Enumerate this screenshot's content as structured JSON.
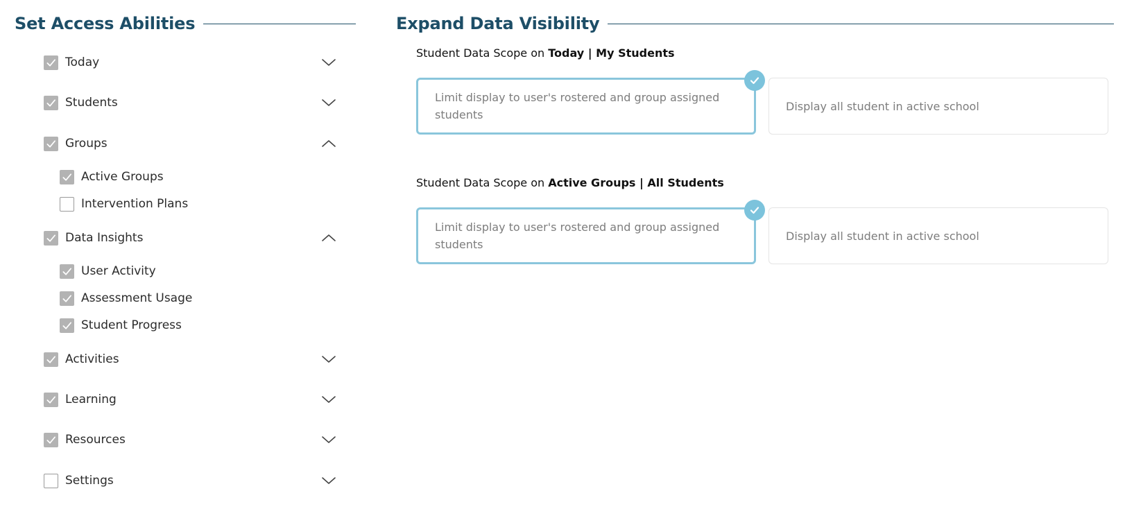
{
  "access": {
    "title": "Set Access Abilities",
    "items": [
      {
        "label": "Today",
        "checked": true,
        "chevron": "chevron-down-icon"
      },
      {
        "label": "Students",
        "checked": true,
        "chevron": "chevron-down-icon"
      },
      {
        "label": "Groups",
        "checked": true,
        "chevron": "chevron-up-icon",
        "children": [
          {
            "label": "Active Groups",
            "checked": true
          },
          {
            "label": "Intervention Plans",
            "checked": false
          }
        ]
      },
      {
        "label": "Data Insights",
        "checked": true,
        "chevron": "chevron-up-icon",
        "children": [
          {
            "label": "User Activity",
            "checked": true
          },
          {
            "label": "Assessment Usage",
            "checked": true
          },
          {
            "label": "Student Progress",
            "checked": true
          }
        ]
      },
      {
        "label": "Activities",
        "checked": true,
        "chevron": "chevron-down-icon"
      },
      {
        "label": "Learning",
        "checked": true,
        "chevron": "chevron-down-icon"
      },
      {
        "label": "Resources",
        "checked": true,
        "chevron": "chevron-down-icon"
      },
      {
        "label": "Settings",
        "checked": false,
        "chevron": "chevron-down-icon"
      }
    ]
  },
  "visibility": {
    "title": "Expand Data Visibility",
    "scopes": [
      {
        "prefix": "Student Data Scope on ",
        "bold": "Today | My Students",
        "options": [
          {
            "label": "Limit display to user's rostered and group assigned students",
            "selected": true
          },
          {
            "label": "Display all student in active school",
            "selected": false
          }
        ]
      },
      {
        "prefix": "Student Data Scope on ",
        "bold": "Active Groups | All Students",
        "options": [
          {
            "label": "Limit display to user's rostered and group assigned students",
            "selected": true
          },
          {
            "label": "Display all student in active school",
            "selected": false
          }
        ]
      }
    ]
  },
  "colors": {
    "heading": "#1d4e67",
    "checkbox_checked": "#b3b3b3",
    "selected_border": "#8ac6dc",
    "tick_badge": "#7cc3dc"
  }
}
